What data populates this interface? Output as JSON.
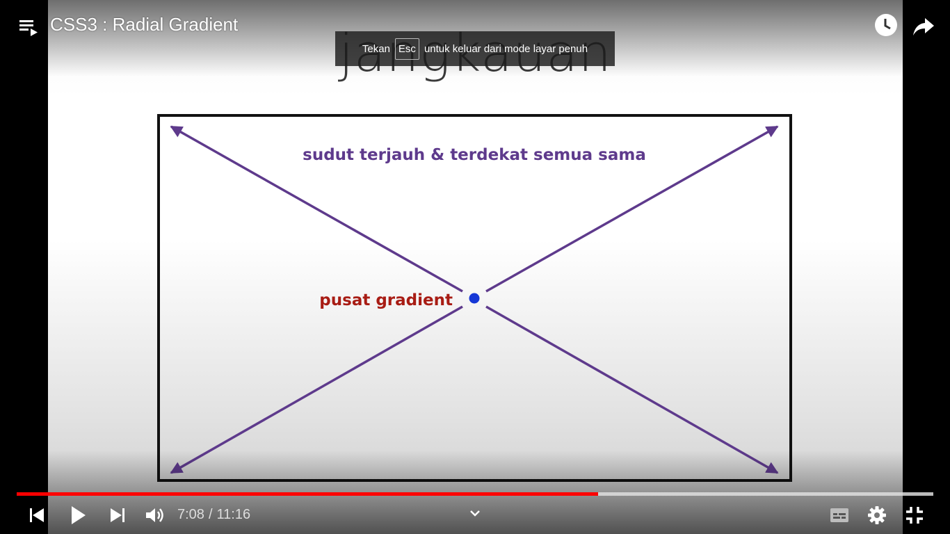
{
  "header": {
    "title": "CSS3 : Radial Gradient"
  },
  "slide": {
    "heading": "jangkauan",
    "corner_label": "sudut terjauh & terdekat semua sama",
    "center_label": "pusat gradient",
    "colors": {
      "arrow": "#5e3a8c",
      "center_label": "#a81c14",
      "center_dot": "#1537d6",
      "frame": "#111111"
    }
  },
  "toast": {
    "before": "Tekan",
    "key": "Esc",
    "after": "untuk keluar dari mode layar penuh"
  },
  "player": {
    "current_time": "7:08",
    "duration": "11:16",
    "played_fraction": 0.634,
    "loaded_fraction": 1.0,
    "progress_color": "#ff0000",
    "icons": [
      "playlist-icon",
      "watch-later-icon",
      "share-icon",
      "previous-icon",
      "play-icon",
      "next-icon",
      "volume-icon",
      "chevron-down-icon",
      "subtitles-icon",
      "settings-icon",
      "exit-fullscreen-icon"
    ]
  }
}
